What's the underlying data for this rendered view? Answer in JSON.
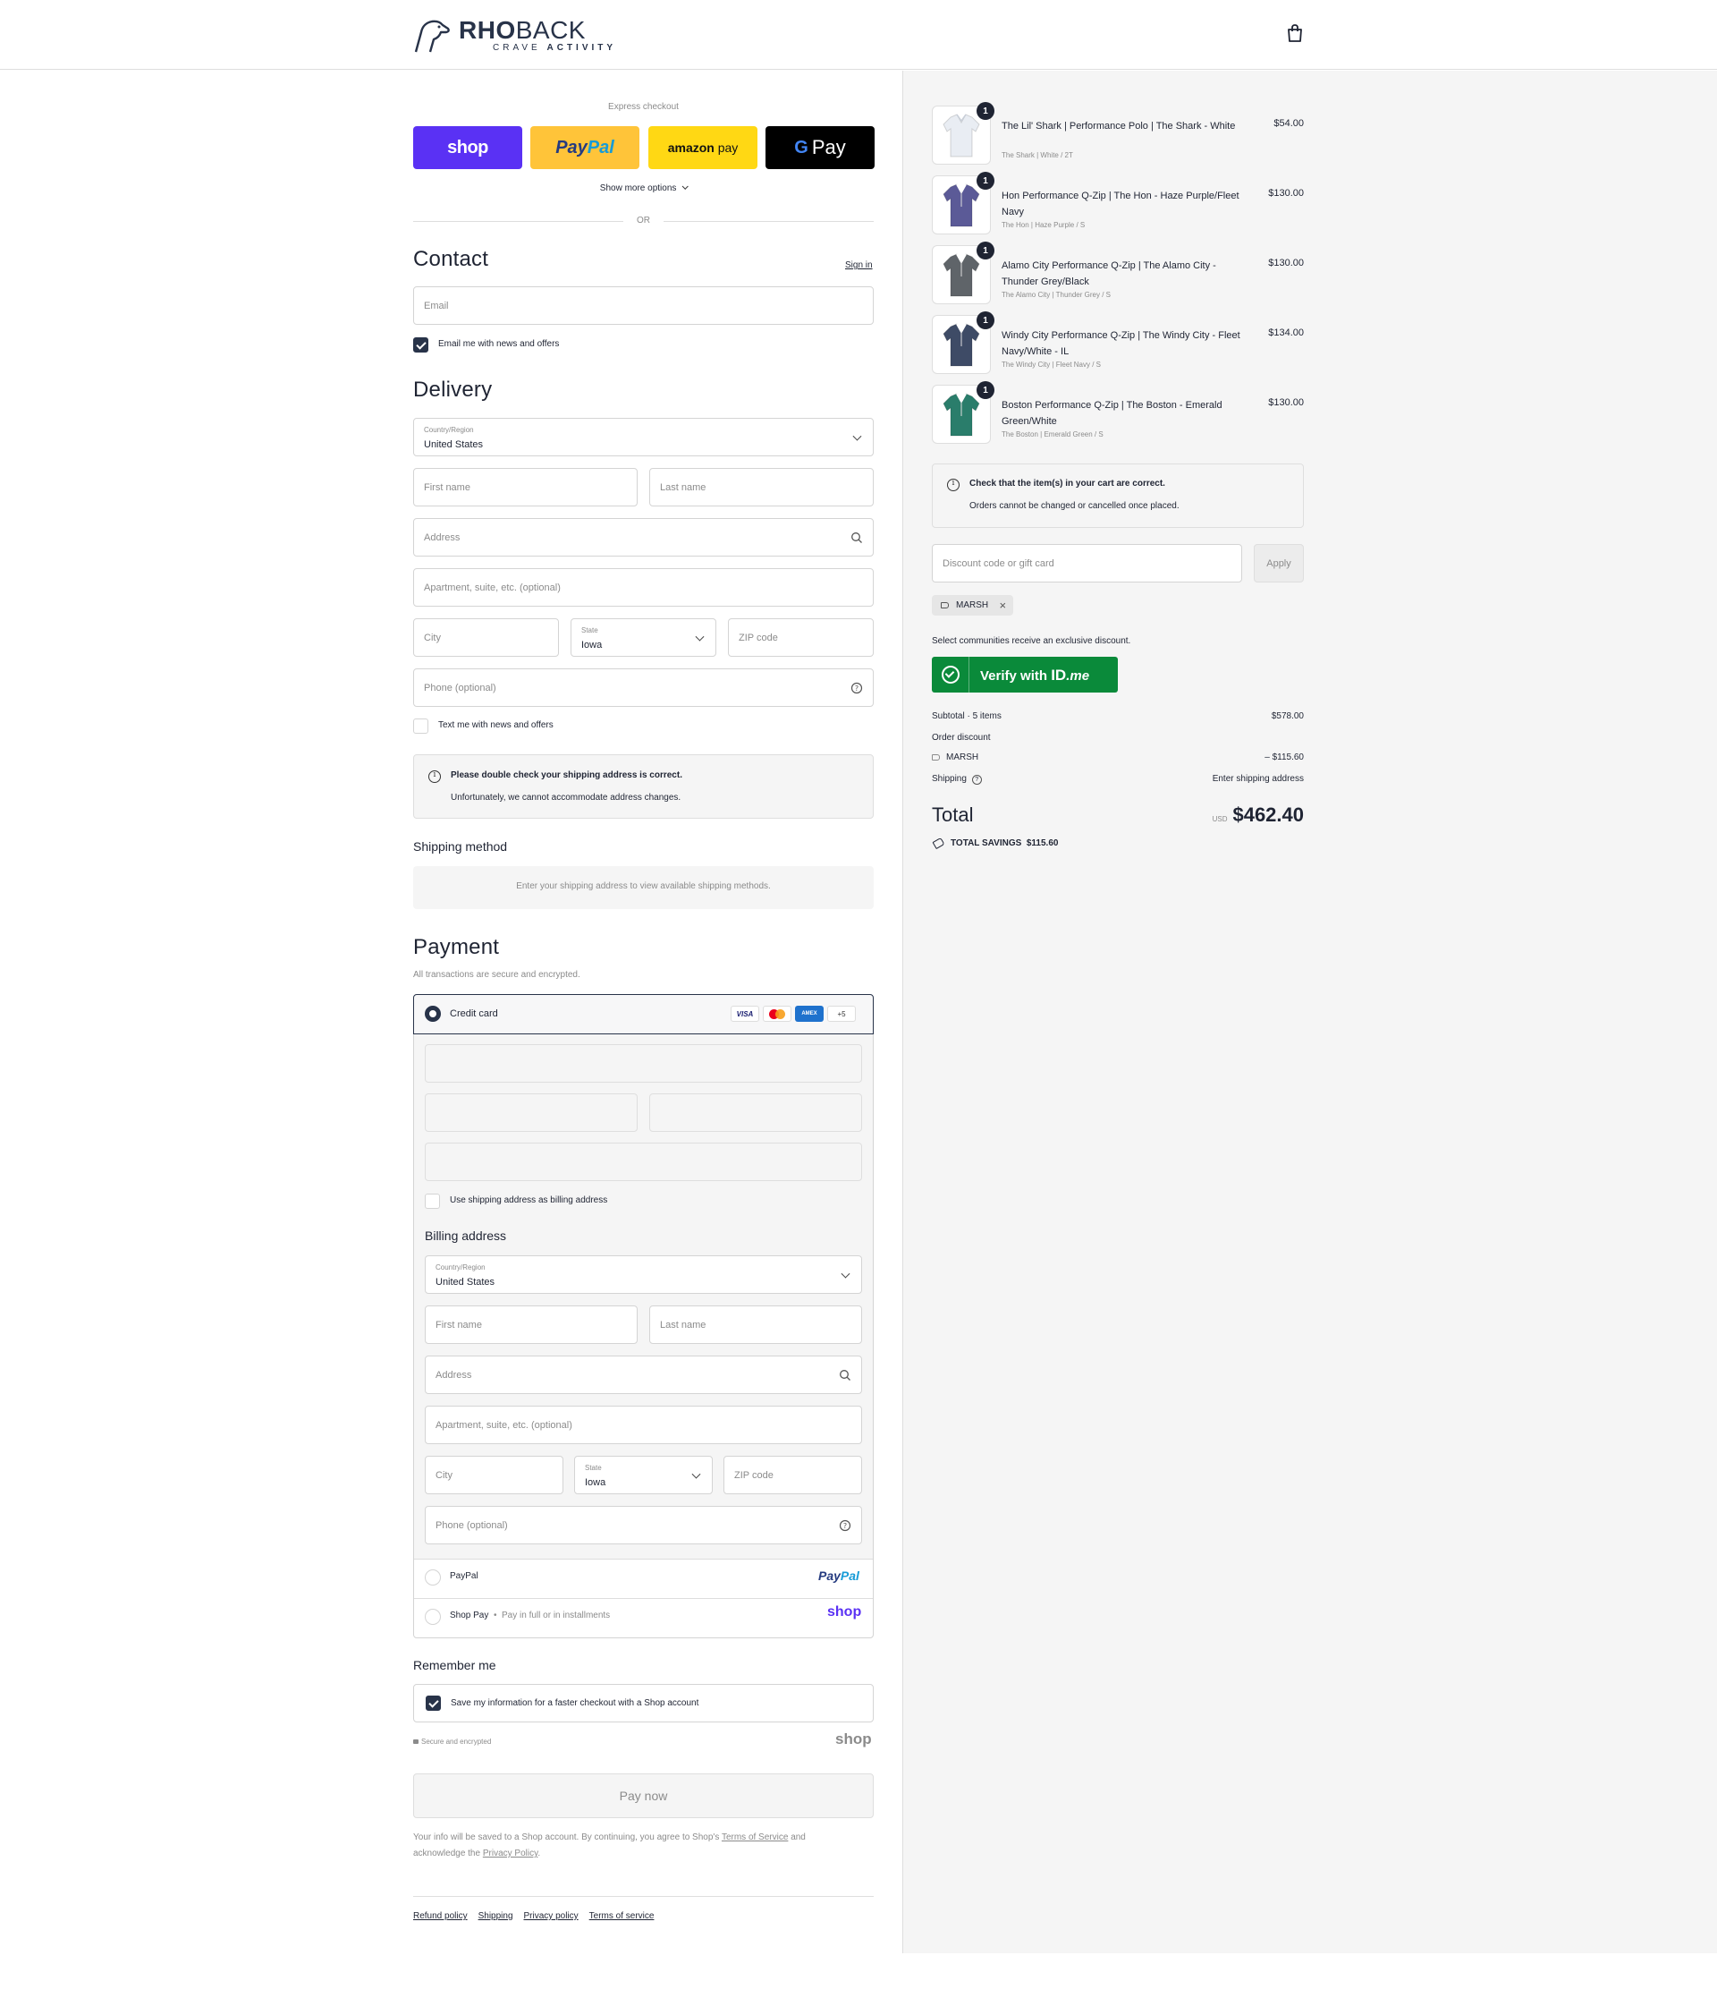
{
  "brand": {
    "name_bold": "RHO",
    "name_light": "BACK",
    "tagline_a": "CRAVE",
    "tagline_b": "ACTIVITY"
  },
  "express": {
    "label": "Express checkout",
    "shop_label": "shop",
    "paypal_a": "Pay",
    "paypal_b": "Pal",
    "amazon_a": "amazon",
    "amazon_b": "pay",
    "gpay_label": "Pay",
    "show_more": "Show more options",
    "or": "OR"
  },
  "contact": {
    "title": "Contact",
    "sign_in": "Sign in",
    "email_placeholder": "Email",
    "news_label": "Email me with news and offers",
    "news_checked": true
  },
  "delivery": {
    "title": "Delivery",
    "country_label": "Country/Region",
    "country_value": "United States",
    "first_name": "First name",
    "last_name": "Last name",
    "address": "Address",
    "apartment": "Apartment, suite, etc. (optional)",
    "city": "City",
    "state_label": "State",
    "state_value": "Iowa",
    "zip": "ZIP code",
    "phone": "Phone (optional)",
    "sms_label": "Text me with news and offers",
    "notice_title": "Please double check your shipping address is correct.",
    "notice_body": "Unfortunately, we cannot accommodate address changes."
  },
  "shipping": {
    "title": "Shipping method",
    "empty": "Enter your shipping address to view available shipping methods."
  },
  "payment": {
    "title": "Payment",
    "subtitle": "All transactions are secure and encrypted.",
    "credit_card": "Credit card",
    "card_logos": [
      "VISA",
      "AMEX"
    ],
    "more_cards": "+5",
    "use_shipping": "Use shipping address as billing address",
    "billing_title": "Billing address",
    "billing_country_label": "Country/Region",
    "billing_country_value": "United States",
    "billing_state_label": "State",
    "billing_state_value": "Iowa",
    "paypal": "PayPal",
    "paypal_logo_a": "Pay",
    "paypal_logo_b": "Pal",
    "shop_pay": "Shop Pay",
    "shop_pay_dot": "•",
    "shop_pay_sub": "Pay in full or in installments",
    "shop_logo": "shop"
  },
  "remember": {
    "title": "Remember me",
    "save_label": "Save my information for a faster checkout with a Shop account",
    "secure": "Secure and encrypted",
    "shop_logo": "shop"
  },
  "pay_now": "Pay now",
  "legal": {
    "text_a": "Your info will be saved to a Shop account. By continuing, you agree to Shop's",
    "tos": "Terms of Service",
    "text_b": "and",
    "text_c": "acknowledge the",
    "privacy": "Privacy Policy",
    "dot": "."
  },
  "footer_links": [
    "Refund policy",
    "Shipping",
    "Privacy policy",
    "Terms of service"
  ],
  "cart": {
    "items": [
      {
        "title": "The Lil' Shark | Performance Polo | The Shark - White",
        "variant": "The Shark | White / 2T",
        "price": "$54.00",
        "qty": "1",
        "color": "#e9edf3"
      },
      {
        "title": "Hon Performance Q-Zip | The Hon - Haze Purple/Fleet Navy",
        "variant": "The Hon | Haze Purple / S",
        "price": "$130.00",
        "qty": "1",
        "color": "#5b5a97"
      },
      {
        "title": "Alamo City Performance Q-Zip | The Alamo City - Thunder Grey/Black",
        "variant": "The Alamo City | Thunder Grey / S",
        "price": "$130.00",
        "qty": "1",
        "color": "#5f6469"
      },
      {
        "title": "Windy City Performance Q-Zip | The Windy City - Fleet Navy/White - IL",
        "variant": "The Windy City | Fleet Navy / S",
        "price": "$134.00",
        "qty": "1",
        "color": "#3e4b66"
      },
      {
        "title": "Boston Performance Q-Zip | The Boston - Emerald Green/White",
        "variant": "The Boston | Emerald Green / S",
        "price": "$130.00",
        "qty": "1",
        "color": "#2a7d6b"
      }
    ],
    "notice_title": "Check that the item(s) in your cart are correct.",
    "notice_body": "Orders cannot be changed or cancelled once placed.",
    "discount_placeholder": "Discount code or gift card",
    "apply": "Apply",
    "code": "MARSH",
    "communities": "Select communities receive an exclusive discount.",
    "verify_label": "Verify with",
    "verify_id": "ID",
    "verify_me": ".me",
    "subtotal_label": "Subtotal · 5 items",
    "subtotal": "$578.00",
    "order_discount": "Order discount",
    "discount_code": "MARSH",
    "discount_value": "– $115.60",
    "shipping_label": "Shipping",
    "shipping_value": "Enter shipping address",
    "total_label": "Total",
    "currency": "USD",
    "total": "$462.40",
    "savings_label": "TOTAL SAVINGS",
    "savings": "$115.60"
  },
  "colors": {
    "accent": "#283349",
    "shop": "#5a31f4",
    "paypal_bg": "#ffc439",
    "amazon_bg": "#ffd814",
    "idme_green": "#0a8a3a"
  }
}
